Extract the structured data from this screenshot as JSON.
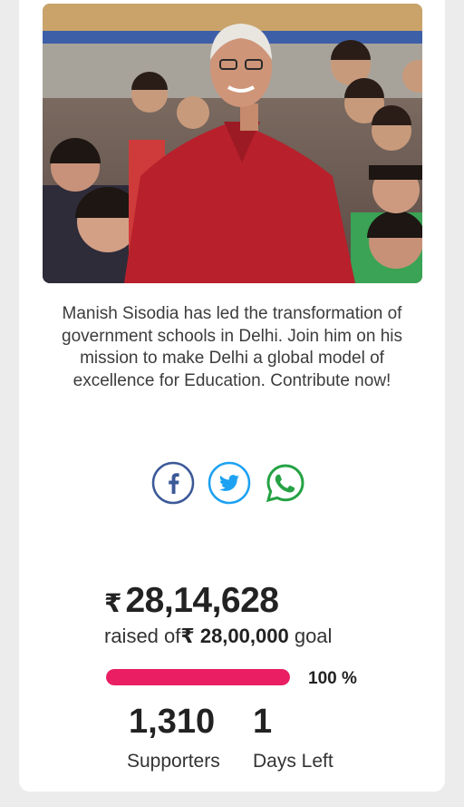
{
  "campaign": {
    "description": "Manish Sisodia has led the transformation of government schools in Delhi. Join him on his mission to make Delhi a global model of excellence for Education. Contribute now!",
    "photo_icon": "photo-of-man-with-students"
  },
  "share": {
    "facebook_icon": "facebook-icon",
    "twitter_icon": "twitter-icon",
    "whatsapp_icon": "whatsapp-icon"
  },
  "funding": {
    "currency_symbol": "₹",
    "raised_amount": "28,14,628",
    "raised_prefix": "raised of",
    "goal_amount": "28,00,000",
    "goal_suffix": "goal",
    "progress_percent": 100,
    "progress_label": "100 %",
    "supporters_count": "1,310",
    "supporters_label": "Supporters",
    "days_left_count": "1",
    "days_left_label": "Days Left"
  },
  "colors": {
    "progress": "#e91e63",
    "facebook": "#3b5998",
    "twitter": "#1da1f2",
    "whatsapp": "#25a244"
  }
}
